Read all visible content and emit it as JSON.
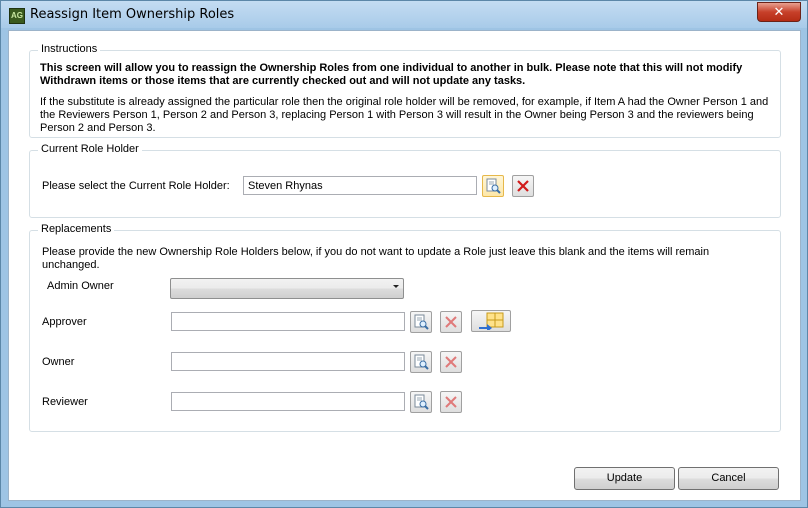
{
  "window": {
    "title": "Reassign Item Ownership Roles",
    "close_label": "✕",
    "app_badge": "AG"
  },
  "instructions": {
    "legend": "Instructions",
    "bold_text": "This screen will allow you to reassign the Ownership Roles from one individual to another in bulk. Please note that this will not modify Withdrawn items or those items that are currently checked out and will not update any tasks.",
    "detail_text": "If the substitute is already assigned the particular role then the original role holder will be removed, for example, if Item A had the Owner Person 1 and the Reviewers Person 1, Person 2 and Person 3, replacing Person 1 with Person 3 will result in the Owner being Person 3 and the reviewers being Person 2 and Person 3."
  },
  "current_role_holder": {
    "legend": "Current Role Holder",
    "label": "Please select the Current Role Holder:",
    "value": "Steven Rhynas"
  },
  "replacements": {
    "legend": "Replacements",
    "description": "Please provide the new Ownership Role Holders below, if you do not want to update a Role just leave this blank and the items will remain unchanged.",
    "admin_owner_label": "Admin Owner",
    "admin_owner_value": "",
    "approver_label": "Approver",
    "approver_value": "",
    "owner_label": "Owner",
    "owner_value": "",
    "reviewer_label": "Reviewer",
    "reviewer_value": ""
  },
  "buttons": {
    "update": "Update",
    "cancel": "Cancel"
  },
  "icons": {
    "browse": "browse-lookup-icon",
    "clear": "red-x-icon",
    "copy": "copy-to-roles-icon"
  },
  "colors": {
    "clear_red": "#d11a1a",
    "title_bar": "#a8cbe9",
    "frame_border": "#d5dfe5"
  }
}
